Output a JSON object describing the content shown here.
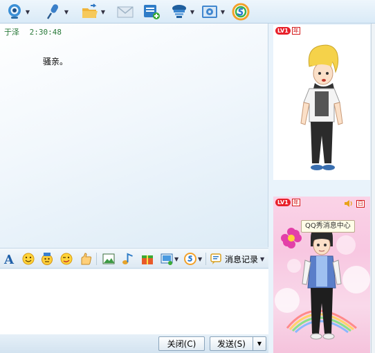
{
  "toolbar": {
    "items": [
      {
        "icon": "video-call-icon",
        "has_dropdown": true
      },
      {
        "icon": "voice-call-icon",
        "has_dropdown": true
      },
      {
        "icon": "send-file-icon",
        "has_dropdown": true
      },
      {
        "icon": "send-email-icon",
        "has_dropdown": false
      },
      {
        "icon": "create-group-icon",
        "has_dropdown": false
      },
      {
        "icon": "remote-assist-icon",
        "has_dropdown": true
      },
      {
        "icon": "app-settings-icon",
        "has_dropdown": true
      },
      {
        "icon": "soso-search-icon",
        "has_dropdown": false
      }
    ]
  },
  "chat": {
    "message": {
      "sender": "于泽",
      "time": "2:30:48",
      "text": "骚亲。"
    },
    "colors": {
      "sender": "#2a7a3a"
    }
  },
  "input_toolbar": {
    "items": [
      "font-icon",
      "smiley-icon",
      "magic-emoticon-icon",
      "wink-icon",
      "nudge-icon",
      "screenshot-icon",
      "music-icon",
      "gift-icon",
      "image-icon",
      "soso-icon"
    ],
    "history_label": "消息记录"
  },
  "buttons": {
    "close_label": "关闭(C)",
    "send_label": "发送(S)"
  },
  "qqshow": {
    "my_level": "LV1",
    "my_badge": "年",
    "peer_level": "LV1",
    "peer_badge": "年",
    "peer_day_badge": "日",
    "tooltip": "QQ秀消息中心"
  }
}
